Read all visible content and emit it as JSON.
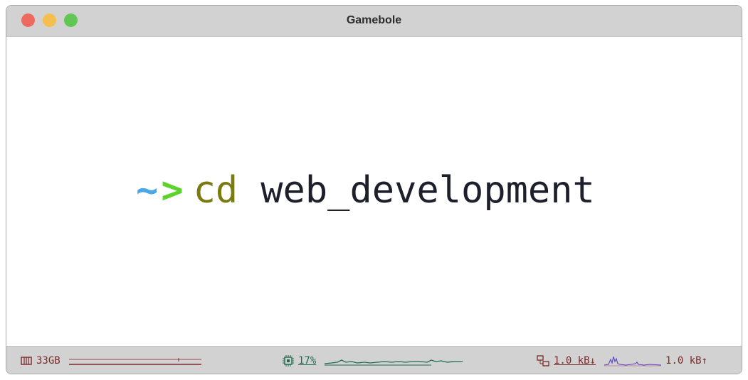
{
  "window": {
    "title": "Gamebole"
  },
  "terminal": {
    "prompt_tilde": "~",
    "prompt_arrow": ">",
    "command": "cd",
    "argument": "web_development"
  },
  "statusbar": {
    "memory": {
      "icon": "memory-icon",
      "value": "33GB",
      "color": "#7a2a2a"
    },
    "cpu": {
      "icon": "cpu-icon",
      "value": "17%",
      "color": "#1f6b4c"
    },
    "network": {
      "icon": "network-icon",
      "down": "1.0 kB↓",
      "up": "1.0 kB↑",
      "down_color": "#7a2a2a",
      "graph_color": "#5b3fc9"
    }
  },
  "colors": {
    "tilde": "#4aa8e8",
    "arrow": "#5fd32d",
    "command": "#7a7a12",
    "argument": "#1d1f2a",
    "titlebar": "#d2d2d2"
  }
}
